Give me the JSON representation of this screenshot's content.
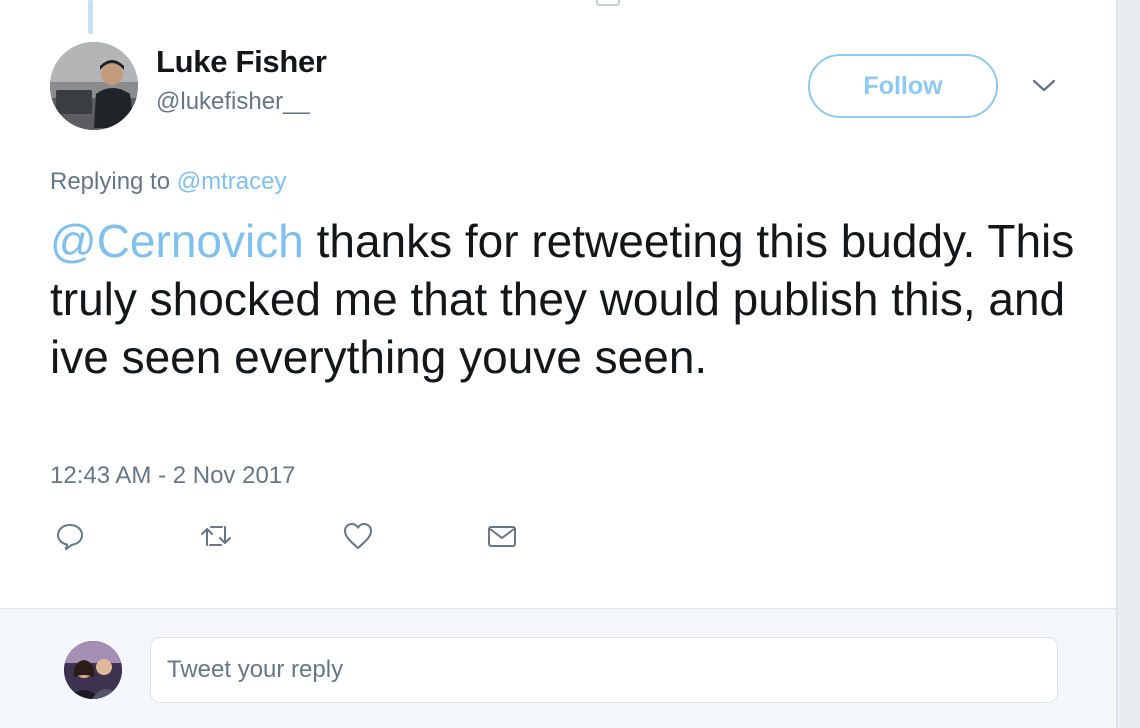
{
  "tweet": {
    "author_name": "Luke Fisher",
    "author_handle": "@lukefisher__",
    "follow_label": "Follow",
    "replying_prefix": "Replying to ",
    "replying_to": "@mtracey",
    "mention": "@Cernovich",
    "body": " thanks for retweeting this buddy. This truly shocked me that they would publish this, and ive seen everything youve seen.",
    "timestamp": "12:43 AM - 2 Nov 2017"
  },
  "actions": [
    {
      "name": "reply",
      "icon": "speech-bubble-icon"
    },
    {
      "name": "retweet",
      "icon": "retweet-icon"
    },
    {
      "name": "like",
      "icon": "heart-icon"
    },
    {
      "name": "message",
      "icon": "envelope-icon"
    }
  ],
  "reply_box": {
    "placeholder": "Tweet your reply"
  },
  "colors": {
    "accent": "#1da1f2",
    "accent_light": "#8ccaf2",
    "text_primary": "#14171a",
    "text_secondary": "#657786",
    "reply_bg": "#f5f8fa"
  }
}
